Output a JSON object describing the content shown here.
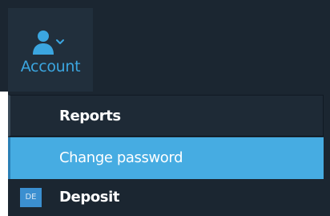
{
  "header": {
    "account_button": {
      "label": "Account",
      "icon": "user-icon",
      "dropdown_icon": "chevron-down-icon"
    }
  },
  "menu": {
    "items": [
      {
        "label": "Reports",
        "state": "default"
      },
      {
        "label": "Change password",
        "state": "hovered"
      },
      {
        "label": "Deposit",
        "badge": "DE",
        "state": "default"
      }
    ]
  },
  "colors": {
    "header_bg": "#1b2631",
    "account_bg": "#212f3c",
    "accent": "#3ba6e0",
    "highlight": "#46ace2",
    "badge": "#3b8fd0",
    "menu_text": "#ffffff"
  }
}
